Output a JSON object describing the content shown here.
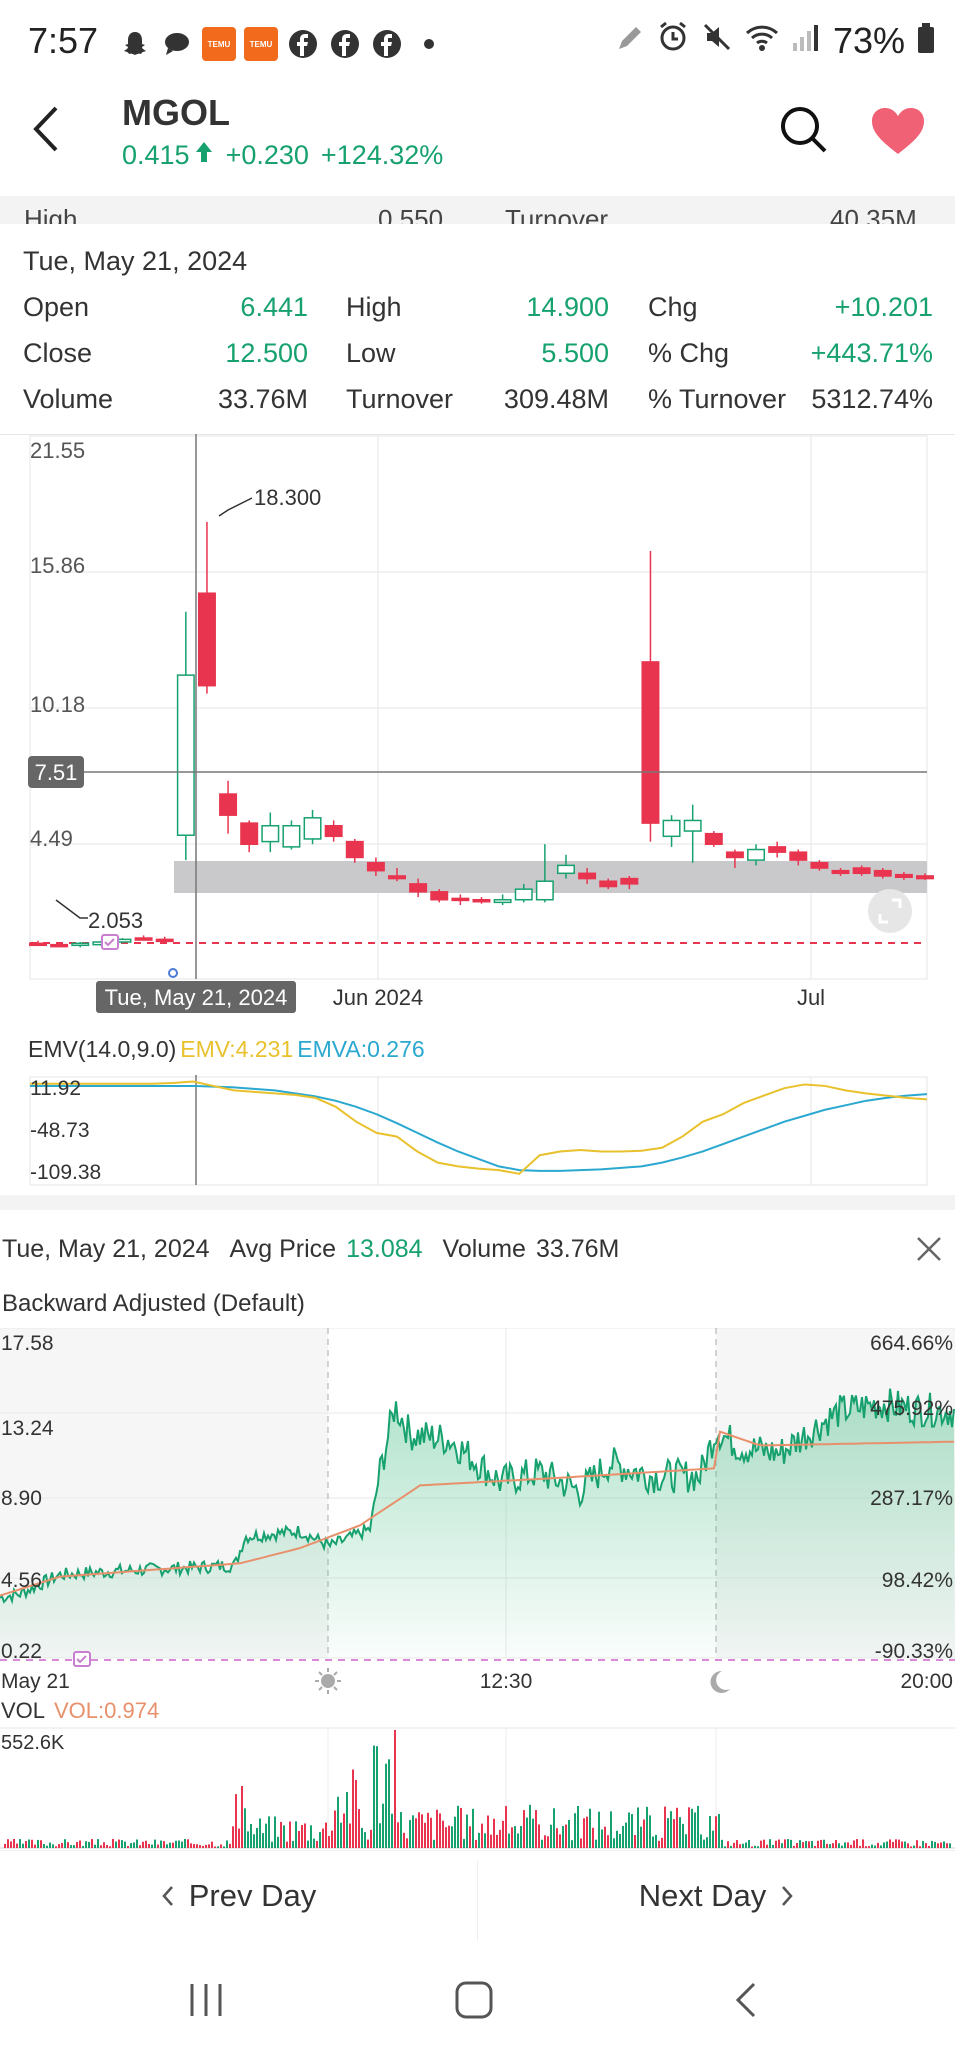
{
  "status_bar": {
    "time": "7:57",
    "battery": "73%",
    "icons": [
      "snapchat-icon",
      "chat-icon",
      "temu-icon",
      "temu-icon",
      "facebook-icon",
      "facebook-icon",
      "facebook-icon",
      "dot-icon",
      "pen-icon",
      "alarm-icon",
      "mute-icon",
      "wifi-icon",
      "signal-icon",
      "battery-icon"
    ],
    "temu_label": "TEMU"
  },
  "header": {
    "symbol": "MGOL",
    "price": "0.415",
    "change": "+0.230",
    "change_pct": "+124.32%"
  },
  "peek_row": {
    "l1": "High",
    "v1": "0.550",
    "l2": "Turnover",
    "v2": "40.35M"
  },
  "info": {
    "date": "Tue, May 21, 2024",
    "open_label": "Open",
    "open": "6.441",
    "close_label": "Close",
    "close": "12.500",
    "volume_label": "Volume",
    "volume": "33.76M",
    "high_label": "High",
    "high": "14.900",
    "low_label": "Low",
    "low": "5.500",
    "turnover_label": "Turnover",
    "turnover": "309.48M",
    "chg_label": "Chg",
    "chg": "+10.201",
    "pchg_label": "% Chg",
    "pchg": "+443.71%",
    "pturn_label": "% Turnover",
    "pturn": "5312.74%"
  },
  "kchart": {
    "y_ticks": [
      "21.55",
      "15.86",
      "10.18",
      "4.49"
    ],
    "crosshair_value": "7.51",
    "high_annotation": "18.300",
    "low_annotation": "2.053",
    "x_labels": [
      "Tue, May 21, 2024",
      "Jun 2024",
      "Jul"
    ]
  },
  "emv": {
    "title": "EMV(14.0,9.0)",
    "emv_label": "EMV:4.231",
    "emva_label": "EMVA:0.276",
    "y_ticks": [
      "11.92",
      "-48.73",
      "-109.38"
    ],
    "emv_color": "#e8c12c",
    "emva_color": "#2aa8cf"
  },
  "intraday": {
    "date": "Tue, May 21, 2024",
    "avg_label": "Avg Price",
    "avg_value": "13.084",
    "vol_label": "Volume",
    "vol_value": "33.76M",
    "adjust_label": "Backward Adjusted (Default)",
    "y_left": [
      "17.58",
      "13.24",
      "8.90",
      "4.56",
      "0.22"
    ],
    "y_right": [
      "664.66%",
      "475.92%",
      "287.17%",
      "98.42%",
      "-90.33%"
    ],
    "x_labels": [
      "May 21",
      "12:30",
      "20:00"
    ],
    "vol_title": "VOL",
    "vol_metric": "VOL:0.974",
    "vol_max": "552.6K"
  },
  "nav": {
    "prev": "Prev Day",
    "next": "Next Day"
  },
  "colors": {
    "up": "#16a16e",
    "down": "#e8344e",
    "accent_heart": "#f06176"
  },
  "chart_data": {
    "type": "candlestick",
    "candles": [
      {
        "o": 2.35,
        "h": 2.45,
        "l": 2.25,
        "c": 2.3
      },
      {
        "o": 2.3,
        "h": 2.4,
        "l": 2.2,
        "c": 2.25
      },
      {
        "o": 2.28,
        "h": 2.4,
        "l": 2.2,
        "c": 2.35
      },
      {
        "o": 2.3,
        "h": 2.45,
        "l": 2.25,
        "c": 2.4
      },
      {
        "o": 2.4,
        "h": 2.55,
        "l": 2.35,
        "c": 2.5
      },
      {
        "o": 2.55,
        "h": 2.65,
        "l": 2.45,
        "c": 2.5
      },
      {
        "o": 2.5,
        "h": 2.6,
        "l": 2.4,
        "c": 2.45
      },
      {
        "o": 6.441,
        "h": 14.9,
        "l": 5.5,
        "c": 12.5
      },
      {
        "o": 15.6,
        "h": 18.3,
        "l": 11.8,
        "c": 12.1
      },
      {
        "o": 8.0,
        "h": 8.5,
        "l": 6.5,
        "c": 7.2
      },
      {
        "o": 6.9,
        "h": 7.0,
        "l": 5.8,
        "c": 6.1
      },
      {
        "o": 6.2,
        "h": 7.3,
        "l": 5.8,
        "c": 6.8
      },
      {
        "o": 6.0,
        "h": 7.0,
        "l": 5.9,
        "c": 6.8
      },
      {
        "o": 6.3,
        "h": 7.4,
        "l": 6.1,
        "c": 7.1
      },
      {
        "o": 6.8,
        "h": 7.0,
        "l": 6.2,
        "c": 6.4
      },
      {
        "o": 6.2,
        "h": 6.3,
        "l": 5.4,
        "c": 5.6
      },
      {
        "o": 5.4,
        "h": 5.6,
        "l": 4.9,
        "c": 5.1
      },
      {
        "o": 4.9,
        "h": 5.2,
        "l": 4.7,
        "c": 4.8
      },
      {
        "o": 4.6,
        "h": 4.8,
        "l": 4.1,
        "c": 4.3
      },
      {
        "o": 4.3,
        "h": 4.4,
        "l": 3.9,
        "c": 4.0
      },
      {
        "o": 4.05,
        "h": 4.2,
        "l": 3.8,
        "c": 4.0
      },
      {
        "o": 4.0,
        "h": 4.1,
        "l": 3.85,
        "c": 3.95
      },
      {
        "o": 3.9,
        "h": 4.2,
        "l": 3.8,
        "c": 4.0
      },
      {
        "o": 4.0,
        "h": 4.6,
        "l": 3.9,
        "c": 4.4
      },
      {
        "o": 4.0,
        "h": 6.1,
        "l": 3.9,
        "c": 4.7
      },
      {
        "o": 5.0,
        "h": 5.7,
        "l": 4.8,
        "c": 5.3
      },
      {
        "o": 5.0,
        "h": 5.2,
        "l": 4.6,
        "c": 4.8
      },
      {
        "o": 4.7,
        "h": 4.8,
        "l": 4.4,
        "c": 4.5
      },
      {
        "o": 4.8,
        "h": 4.9,
        "l": 4.4,
        "c": 4.6
      },
      {
        "o": 13.0,
        "h": 17.2,
        "l": 6.2,
        "c": 6.9
      },
      {
        "o": 6.4,
        "h": 7.2,
        "l": 6.0,
        "c": 7.0
      },
      {
        "o": 6.6,
        "h": 7.6,
        "l": 5.4,
        "c": 7.0
      },
      {
        "o": 6.5,
        "h": 6.6,
        "l": 6.0,
        "c": 6.1
      },
      {
        "o": 5.8,
        "h": 5.9,
        "l": 5.2,
        "c": 5.6
      },
      {
        "o": 5.5,
        "h": 6.1,
        "l": 5.3,
        "c": 5.9
      },
      {
        "o": 6.0,
        "h": 6.2,
        "l": 5.6,
        "c": 5.8
      },
      {
        "o": 5.8,
        "h": 5.9,
        "l": 5.3,
        "c": 5.5
      },
      {
        "o": 5.4,
        "h": 5.5,
        "l": 5.1,
        "c": 5.2
      },
      {
        "o": 5.1,
        "h": 5.2,
        "l": 4.9,
        "c": 5.0
      },
      {
        "o": 5.2,
        "h": 5.3,
        "l": 4.9,
        "c": 5.0
      },
      {
        "o": 5.1,
        "h": 5.2,
        "l": 4.8,
        "c": 4.9
      },
      {
        "o": 4.95,
        "h": 5.05,
        "l": 4.75,
        "c": 4.85
      },
      {
        "o": 4.9,
        "h": 5.0,
        "l": 4.75,
        "c": 4.8
      }
    ],
    "y_range": [
      1.0,
      21.55
    ],
    "emv": [
      11,
      11,
      11,
      11,
      11,
      11,
      11,
      12,
      14,
      8,
      2,
      0,
      -2,
      -4,
      -8,
      -20,
      -40,
      -55,
      -60,
      -80,
      -95,
      -100,
      -103,
      -105,
      -110,
      -85,
      -80,
      -78,
      -80,
      -80,
      -79,
      -75,
      -60,
      -40,
      -30,
      -15,
      -5,
      5,
      10,
      8,
      2,
      -2,
      -5,
      -8,
      -10
    ],
    "emva": [
      8,
      8,
      8,
      8,
      8,
      8,
      8,
      8,
      8,
      7,
      6,
      4,
      2,
      -2,
      -6,
      -12,
      -20,
      -30,
      -42,
      -55,
      -68,
      -80,
      -90,
      -100,
      -105,
      -106,
      -106,
      -105,
      -104,
      -102,
      -100,
      -95,
      -88,
      -80,
      -70,
      -60,
      -50,
      -40,
      -32,
      -24,
      -18,
      -12,
      -8,
      -5,
      -3
    ],
    "emv_range": [
      -125,
      20
    ],
    "intraday_range": [
      0.22,
      17.58
    ]
  }
}
